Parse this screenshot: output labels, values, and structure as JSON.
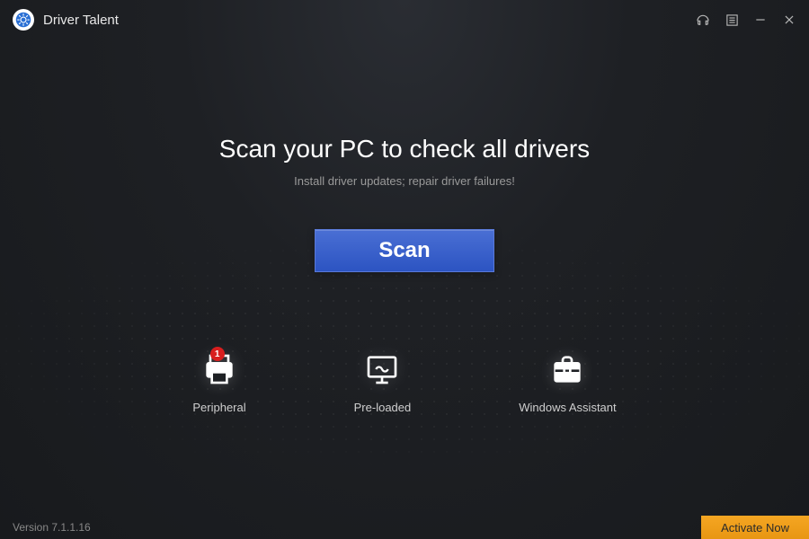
{
  "app": {
    "title": "Driver Talent"
  },
  "main": {
    "headline": "Scan your PC to check all drivers",
    "subtext": "Install driver updates; repair driver failures!",
    "scan_label": "Scan"
  },
  "tools": {
    "peripheral": {
      "label": "Peripheral",
      "badge": "1"
    },
    "preloaded": {
      "label": "Pre-loaded"
    },
    "assistant": {
      "label": "Windows Assistant"
    }
  },
  "footer": {
    "version": "Version 7.1.1.16",
    "activate_label": "Activate Now"
  },
  "colors": {
    "accent": "#2c54c2",
    "activate": "#e89612",
    "badge": "#d81e1e"
  }
}
